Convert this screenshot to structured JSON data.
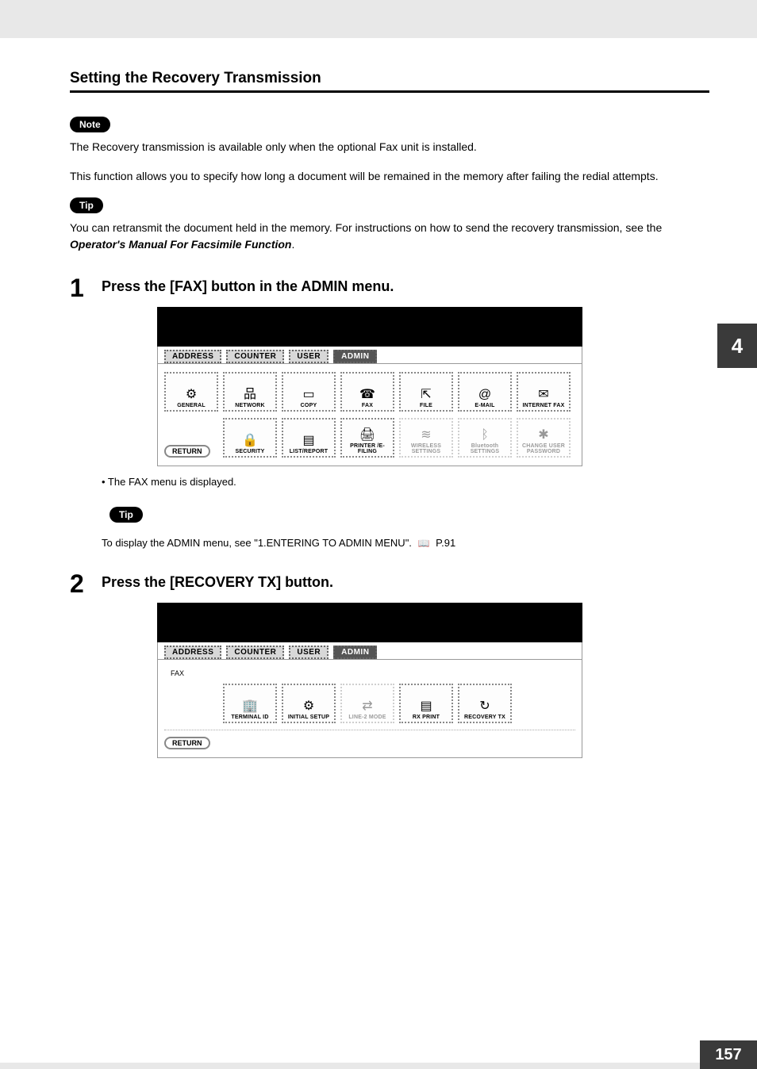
{
  "header": {
    "title": "Setting the Recovery Transmission"
  },
  "note": {
    "badge": "Note",
    "text": "The Recovery transmission is available only when the optional Fax unit is installed."
  },
  "intro": "This function allows you to specify how long a document will be remained in the memory after failing the redial attempts.",
  "tip1": {
    "badge": "Tip",
    "text1": "You can retransmit the document held in the memory.  For instructions on how to send the recovery transmission, see the ",
    "italic": "Operator's Manual For Facsimile Function",
    "text2": "."
  },
  "step1": {
    "num": "1",
    "text": "Press the [FAX] button in the ADMIN menu.",
    "bullet": "•  The FAX menu is displayed."
  },
  "screen1": {
    "tabs": {
      "t0": "ADDRESS",
      "t1": "COUNTER",
      "t2": "USER",
      "t3": "ADMIN"
    },
    "row1": {
      "b0": "GENERAL",
      "b1": "NETWORK",
      "b2": "COPY",
      "b3": "FAX",
      "b4": "FILE",
      "b5": "E-MAIL",
      "b6": "INTERNET FAX"
    },
    "row2": {
      "b0": "SECURITY",
      "b1": "LIST/REPORT",
      "b2": "PRINTER /E-FILING",
      "b3": "WIRELESS SETTINGS",
      "b4": "Bluetooth SETTINGS",
      "b5": "CHANGE USER PASSWORD"
    },
    "return": "RETURN"
  },
  "tip2": {
    "badge": "Tip",
    "text": "To display the ADMIN menu, see \"1.ENTERING TO ADMIN MENU\".",
    "page_ref": "P.91"
  },
  "step2": {
    "num": "2",
    "text": "Press the [RECOVERY TX] button."
  },
  "screen2": {
    "tabs": {
      "t0": "ADDRESS",
      "t1": "COUNTER",
      "t2": "USER",
      "t3": "ADMIN"
    },
    "sub": "FAX",
    "row1": {
      "b0": "TERMINAL ID",
      "b1": "INITIAL SETUP",
      "b2": "LINE-2 MODE",
      "b3": "RX PRINT",
      "b4": "RECOVERY TX"
    },
    "return": "RETURN"
  },
  "side_tab": "4",
  "page_number": "157"
}
